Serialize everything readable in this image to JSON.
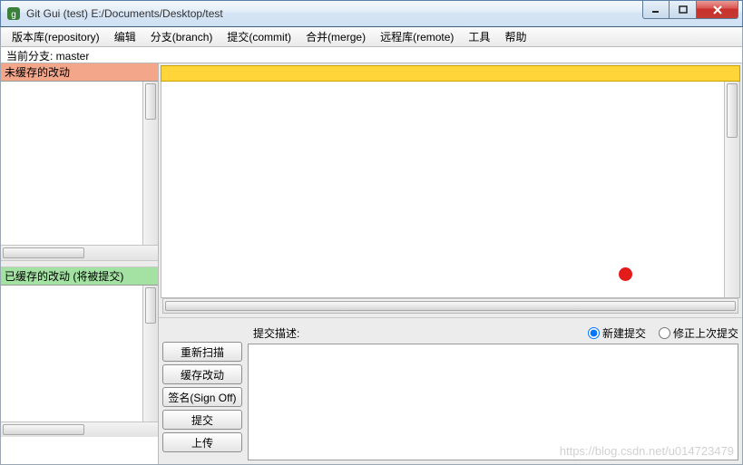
{
  "window": {
    "title": "Git Gui (test) E:/Documents/Desktop/test"
  },
  "menu": {
    "repository": "版本库(repository)",
    "edit": "编辑",
    "branch": "分支(branch)",
    "commit": "提交(commit)",
    "merge": "合并(merge)",
    "remote": "远程库(remote)",
    "tools": "工具",
    "help": "帮助"
  },
  "branch_bar": "当前分支: master",
  "panels": {
    "unstaged_header": "未缓存的改动",
    "staged_header": "已缓存的改动 (将被提交)"
  },
  "commit": {
    "desc_label": "提交描述:",
    "radio_new": "新建提交",
    "radio_amend": "修正上次提交",
    "buttons": {
      "rescan": "重新扫描",
      "stage": "缓存改动",
      "signoff": "签名(Sign Off)",
      "commit": "提交",
      "push": "上传"
    }
  },
  "watermark": "https://blog.csdn.net/u014723479"
}
